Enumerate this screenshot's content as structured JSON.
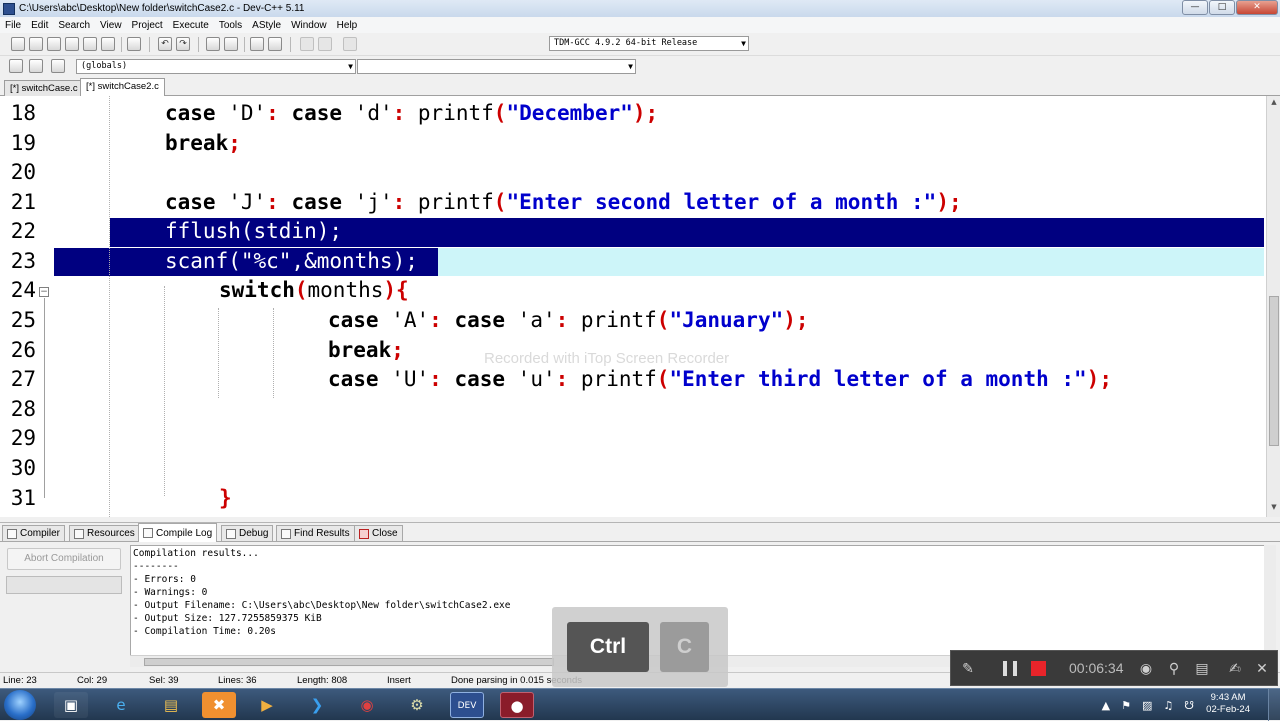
{
  "window": {
    "title": "C:\\Users\\abc\\Desktop\\New folder\\switchCase2.c - Dev-C++ 5.11"
  },
  "menu": [
    "File",
    "Edit",
    "Search",
    "View",
    "Project",
    "Execute",
    "Tools",
    "AStyle",
    "Window",
    "Help"
  ],
  "toolbar": {
    "compiler_select": "TDM-GCC 4.9.2 64-bit Release",
    "scope_select": "(globals)",
    "member_select": ""
  },
  "file_tabs": [
    "[*] switchCase.c",
    "[*] switchCase2.c"
  ],
  "editor": {
    "line_numbers": [
      "18",
      "19",
      "20",
      "21",
      "22",
      "23",
      "24",
      "25",
      "26",
      "27",
      "28",
      "29",
      "30",
      "31"
    ],
    "lines": [
      {
        "t1": "case",
        "s1": " 'D'",
        "p1": ":",
        "t2": " case",
        "s2": " 'd'",
        "p2": ":",
        "t3": " printf",
        "p3": "(",
        "q": "\"December\"",
        "p4": ");"
      },
      {
        "kw": "break",
        "pu": ";"
      },
      {},
      {
        "t1": "case",
        "s1": " 'J'",
        "p1": ":",
        "t2": " case",
        "s2": " 'j'",
        "p2": ":",
        "t3": " printf",
        "p3": "(",
        "q": "\"Enter second letter of a month :\"",
        "p4": ");"
      },
      {
        "plain": "fflush(stdin);"
      },
      {
        "plain": "scanf(\"%c\",&months);"
      },
      {
        "kw": "switch",
        "p1": "(",
        "mid": "months",
        "p2": "){"
      },
      {
        "t1": "case",
        "s1": " 'A'",
        "p1": ":",
        "t2": " case",
        "s2": " 'a'",
        "p2": ":",
        "t3": " printf",
        "p3": "(",
        "q": "\"January\"",
        "p4": ");"
      },
      {
        "kw": "break",
        "pu": ";"
      },
      {
        "t1": "case",
        "s1": " 'U'",
        "p1": ":",
        "t2": " case",
        "s2": " 'u'",
        "p2": ":",
        "t3": " printf",
        "p3": "(",
        "q": "\"Enter third letter of a month :\"",
        "p4": ");"
      },
      {},
      {},
      {},
      {
        "pu": "}"
      }
    ],
    "watermark": "Recorded with iTop Screen Recorder"
  },
  "bottom_tabs": [
    "Compiler",
    "Resources",
    "Compile Log",
    "Debug",
    "Find Results",
    "Close"
  ],
  "compile": {
    "abort_label": "Abort Compilation",
    "log": [
      "Compilation results...",
      "--------",
      "- Errors: 0",
      "- Warnings: 0",
      "- Output Filename: C:\\Users\\abc\\Desktop\\New folder\\switchCase2.exe",
      "- Output Size: 127.7255859375 KiB",
      "- Compilation Time: 0.20s"
    ]
  },
  "status": {
    "line": "Line:    23",
    "col": "Col:    29",
    "sel": "Sel:    39",
    "lines": "Lines:    36",
    "length": "Length:  808",
    "mode": "Insert",
    "parse": "Done parsing in 0.015 seconds"
  },
  "keys": {
    "k1": "Ctrl",
    "k2": "C"
  },
  "recorder": {
    "time": "00:06:34"
  },
  "clock": {
    "time": "9:43 AM",
    "date": "02-Feb-24"
  },
  "colors": {
    "selection": "#000080",
    "current_line": "#cdf5f9",
    "string": "#0000cc",
    "symbol": "#cc0000"
  }
}
